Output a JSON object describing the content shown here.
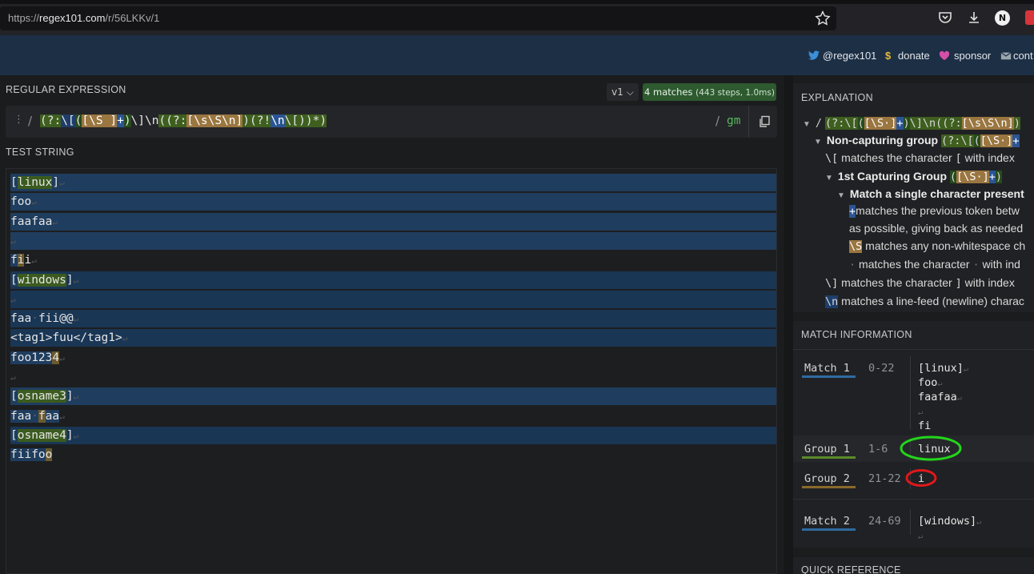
{
  "browser": {
    "url_prefix": "https://",
    "url_host": "regex101.com",
    "url_path": "/r/56LKKv/1",
    "profile_initial": "N"
  },
  "header": {
    "links": [
      {
        "icon": "twitter-icon",
        "label": "@regex101"
      },
      {
        "icon": "dollar-icon",
        "label": "donate"
      },
      {
        "icon": "heart-icon",
        "label": "sponsor"
      },
      {
        "icon": "mail-icon",
        "label": "cont"
      }
    ]
  },
  "regex_panel": {
    "title": "REGULAR EXPRESSION",
    "version": "v1 ⌵",
    "matches_badge": "4 matches",
    "matches_detail": "(443 steps, 1.0ms)",
    "delimiter_open": "/",
    "delimiter_close": "/",
    "pattern": "(?:\\[([\\S ]+)\\]\\n((?:[\\s\\S\\n])(?!\\n\\[))*)",
    "flags": "gm"
  },
  "test_panel": {
    "title": "TEST STRING",
    "lines": [
      "[linux]",
      "foo",
      "faafaa",
      "",
      "fii",
      "[windows]",
      "",
      "faa fii@@",
      "<tag1>fuu</tag1>",
      "foo1234",
      "",
      "[osname3]",
      "faa faa",
      "[osname4]",
      "fiifoo"
    ]
  },
  "explanation": {
    "title": "EXPLANATION",
    "lines": [
      {
        "prefix": "/",
        "code": "(?:\\[([\\S ]+)\\]\\n((?:[\\s\\S\\n]"
      },
      {
        "bold": "Non-capturing group",
        "code": "(?:\\[([\\S ]+"
      },
      {
        "code": "\\[",
        "text": "matches the character",
        "code2": "[",
        "text2": "with index"
      },
      {
        "bold": "1st Capturing Group",
        "code": "([\\S ]+)"
      },
      {
        "bold": "Match a single character present"
      },
      {
        "code": "+",
        "text": "matches the previous token betw"
      },
      {
        "text": "as possible, giving back as needed"
      },
      {
        "code": "\\S",
        "text": "matches any non-whitespace ch"
      },
      {
        "code": "·",
        "text": "matches the character",
        "code2": "·",
        "text2": "with ind"
      },
      {
        "code": "\\]",
        "text": "matches the character",
        "code2": "]",
        "text2": "with index"
      },
      {
        "code": "\\n",
        "text": "matches a line-feed (newline) charac"
      }
    ]
  },
  "match_info": {
    "title": "MATCH INFORMATION",
    "rows": [
      {
        "label": "Match 1",
        "range": "0-22",
        "value": "[linux]\nfoo\nfaafaa\n\nfi"
      },
      {
        "label": "Group 1",
        "range": "1-6",
        "value": "linux"
      },
      {
        "label": "Group 2",
        "range": "21-22",
        "value": "i"
      },
      {
        "label": "Match 2",
        "range": "24-69",
        "value": "[windows]\n"
      }
    ]
  },
  "quick_reference": {
    "title": "QUICK REFERENCE"
  },
  "colors": {
    "header_bg": "#1c2f45",
    "match_bg": "#1f3d5e",
    "group1": "#3b5b1f",
    "group2": "#6b5a30",
    "badge_bg": "#2d5a2f",
    "annotation_green": "#22d61b",
    "annotation_red": "#e0181c"
  }
}
